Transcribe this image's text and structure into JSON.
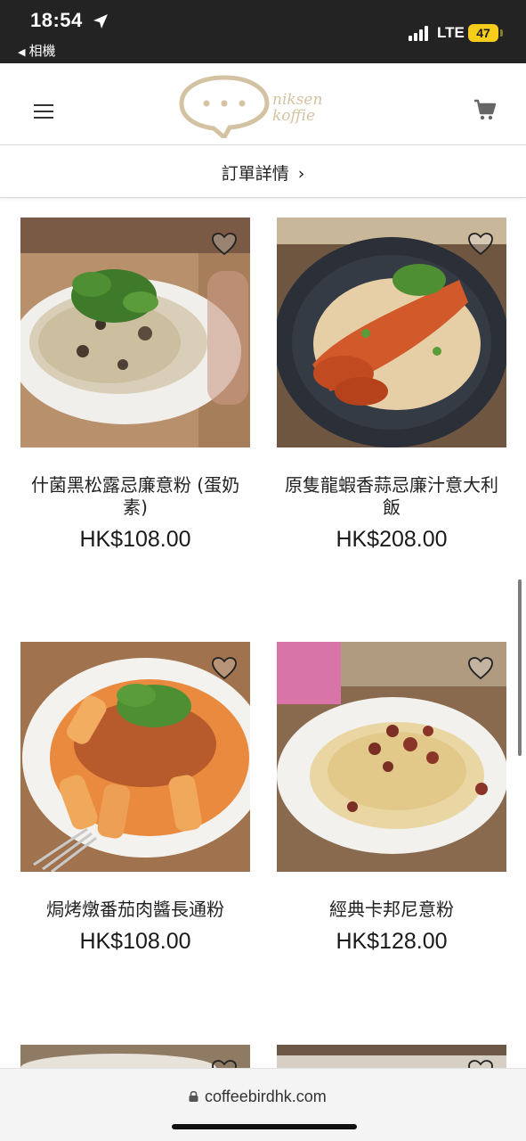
{
  "status_bar": {
    "time": "18:54",
    "back_app": "相機",
    "network": "LTE",
    "battery": "47"
  },
  "header": {
    "logo_text_line1": "niksen",
    "logo_text_line2": "koffie"
  },
  "order_bar": {
    "label": "訂單詳情",
    "chevron": "›"
  },
  "products": [
    {
      "name": "什菌黑松露忌廉意粉 (蛋奶素)",
      "price": "HK$108.00",
      "icon": "heart-outline-icon"
    },
    {
      "name": "原隻龍蝦香蒜忌廉汁意大利飯",
      "price": "HK$208.00",
      "icon": "heart-outline-icon"
    },
    {
      "name": "焗烤燉番茄肉醬長通粉",
      "price": "HK$108.00",
      "icon": "heart-outline-icon"
    },
    {
      "name": "經典卡邦尼意粉",
      "price": "HK$128.00",
      "icon": "heart-outline-icon"
    }
  ],
  "url_bar": {
    "url": "coffeebirdhk.com"
  },
  "colors": {
    "status_bg": "#232323",
    "battery": "#f6cd1a",
    "logo": "#d4c3a2"
  }
}
